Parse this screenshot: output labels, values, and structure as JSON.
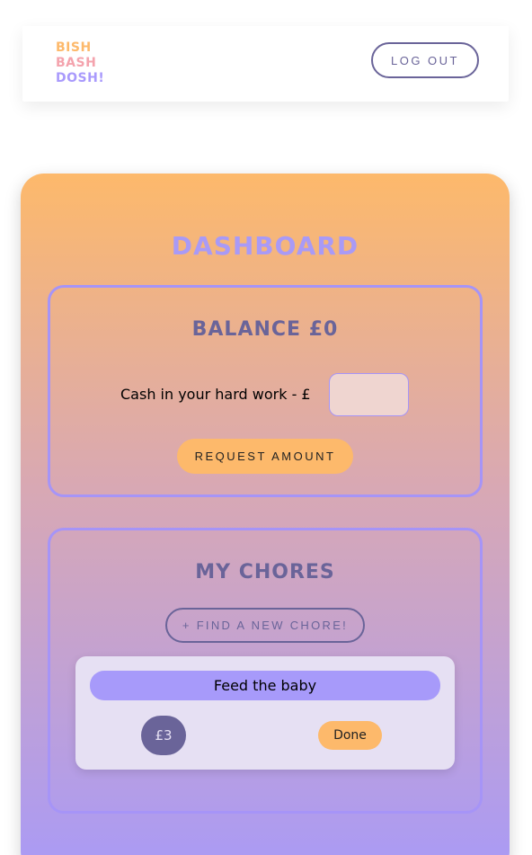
{
  "navbar": {
    "logo_lines": [
      "BISH",
      "BASH",
      "DOSH!"
    ],
    "logout_label": "LOG OUT"
  },
  "dashboard": {
    "title": "DASHBOARD",
    "balance": {
      "title": "BALANCE £0",
      "cash_label": "Cash in your hard work - £",
      "amount_value": "",
      "request_label": "REQUEST AMOUNT"
    },
    "chores": {
      "title": "MY CHORES",
      "find_label": "+ FIND A NEW CHORE!",
      "items": [
        {
          "name": "Feed the baby",
          "price": "£3",
          "done_label": "Done"
        }
      ]
    }
  },
  "colors": {
    "orange": "#fdb96b",
    "pink": "#f4a3ad",
    "lavender": "#a99af6",
    "purple_dark": "#6a6499"
  }
}
